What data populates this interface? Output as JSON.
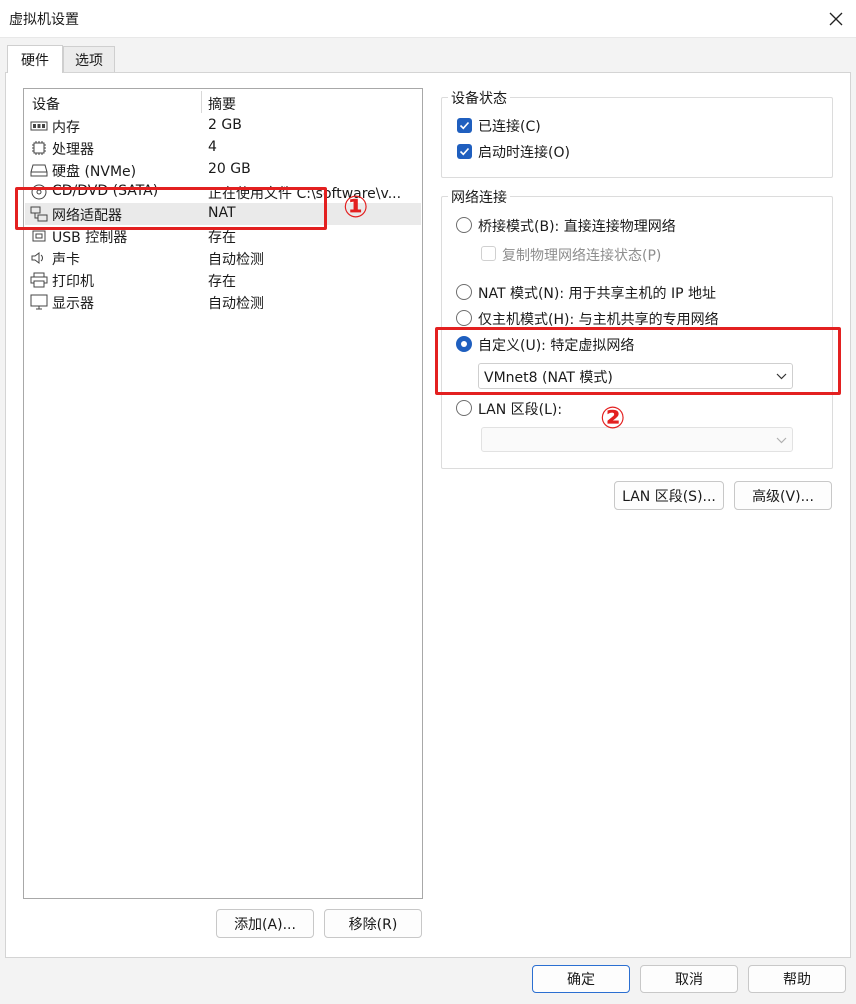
{
  "window": {
    "title": "虚拟机设置"
  },
  "tabs": [
    {
      "label": "硬件"
    },
    {
      "label": "选项"
    }
  ],
  "device_list": {
    "headers": {
      "device": "设备",
      "summary": "摘要"
    },
    "rows": [
      {
        "icon": "memory-icon",
        "name": "内存",
        "summary": "2 GB"
      },
      {
        "icon": "cpu-icon",
        "name": "处理器",
        "summary": "4"
      },
      {
        "icon": "disk-icon",
        "name": "硬盘 (NVMe)",
        "summary": "20 GB"
      },
      {
        "icon": "cd-icon",
        "name": "CD/DVD (SATA)",
        "summary": "正在使用文件 C:\\software\\v..."
      },
      {
        "icon": "network-icon",
        "name": "网络适配器",
        "summary": "NAT"
      },
      {
        "icon": "usb-icon",
        "name": "USB 控制器",
        "summary": "存在"
      },
      {
        "icon": "speaker-icon",
        "name": "声卡",
        "summary": "自动检测"
      },
      {
        "icon": "printer-icon",
        "name": "打印机",
        "summary": "存在"
      },
      {
        "icon": "monitor-icon",
        "name": "显示器",
        "summary": "自动检测"
      }
    ],
    "selected_index": 4
  },
  "list_buttons": {
    "add": "添加(A)...",
    "remove": "移除(R)"
  },
  "device_status": {
    "title": "设备状态",
    "connected": {
      "label": "已连接(C)",
      "checked": true
    },
    "connect_on_power": {
      "label": "启动时连接(O)",
      "checked": true
    }
  },
  "network": {
    "title": "网络连接",
    "bridged": {
      "label": "桥接模式(B): 直接连接物理网络",
      "selected": false
    },
    "replicate": {
      "label": "复制物理网络连接状态(P)",
      "checked": false
    },
    "nat": {
      "label": "NAT 模式(N): 用于共享主机的 IP 地址",
      "selected": false
    },
    "host_only": {
      "label": "仅主机模式(H): 与主机共享的专用网络",
      "selected": false
    },
    "custom": {
      "label": "自定义(U): 特定虚拟网络",
      "selected": true,
      "value": "VMnet8 (NAT 模式)"
    },
    "lan": {
      "label": "LAN 区段(L):",
      "selected": false,
      "value": ""
    }
  },
  "side_buttons": {
    "lan_segments": "LAN 区段(S)...",
    "advanced": "高级(V)..."
  },
  "footer": {
    "ok": "确定",
    "cancel": "取消",
    "help": "帮助"
  },
  "annotations": {
    "marker1": "①",
    "marker2": "②"
  },
  "colors": {
    "accent": "#1f5fbf",
    "annotation": "#e32020"
  }
}
